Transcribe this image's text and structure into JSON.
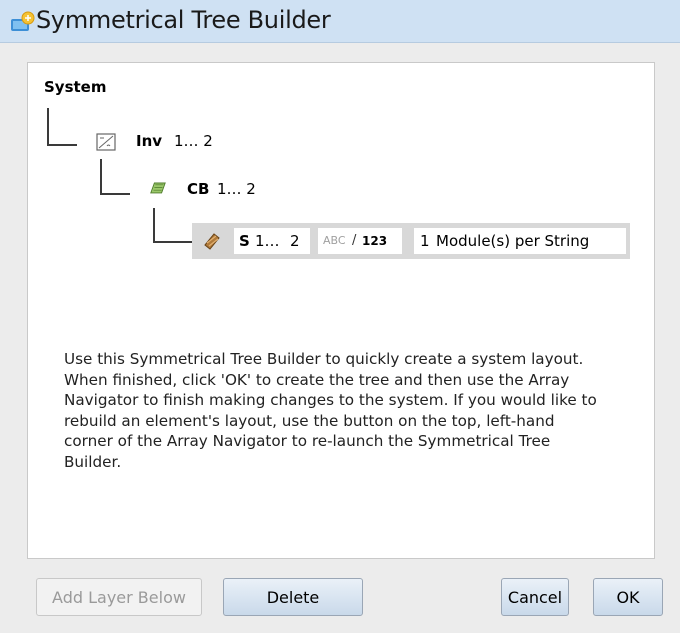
{
  "window": {
    "title": "Symmetrical Tree Builder",
    "icon": "tree-builder-icon"
  },
  "tree": {
    "root_label": "System",
    "nodes": [
      {
        "icon": "inverter-icon",
        "name": "Inv",
        "range": "1… 2"
      },
      {
        "icon": "combiner-box-icon",
        "name": "CB",
        "range": "1… 2"
      }
    ],
    "string_row": {
      "icon": "string-icon",
      "name": "S",
      "range_start": "1…",
      "range_end": "2",
      "toggle_abc": "ABC",
      "toggle_sep": "/",
      "toggle_123": "123",
      "module_count": "1",
      "module_label": "Module(s) per String"
    }
  },
  "description": "Use this Symmetrical Tree Builder to quickly create a system layout. When finished, click 'OK' to create the tree and then use the Array Navigator to finish making changes to the system. If you would like to rebuild an element's layout, use the button on the top, left-hand corner of the Array Navigator to re-launch the Symmetrical Tree Builder.",
  "buttons": {
    "add_layer": "Add Layer Below",
    "delete": "Delete",
    "cancel": "Cancel",
    "ok": "OK"
  },
  "colors": {
    "titlebar": "#cfe1f3",
    "button_gradient_top": "#eaf1f8",
    "button_gradient_bottom": "#c9d9ea"
  }
}
